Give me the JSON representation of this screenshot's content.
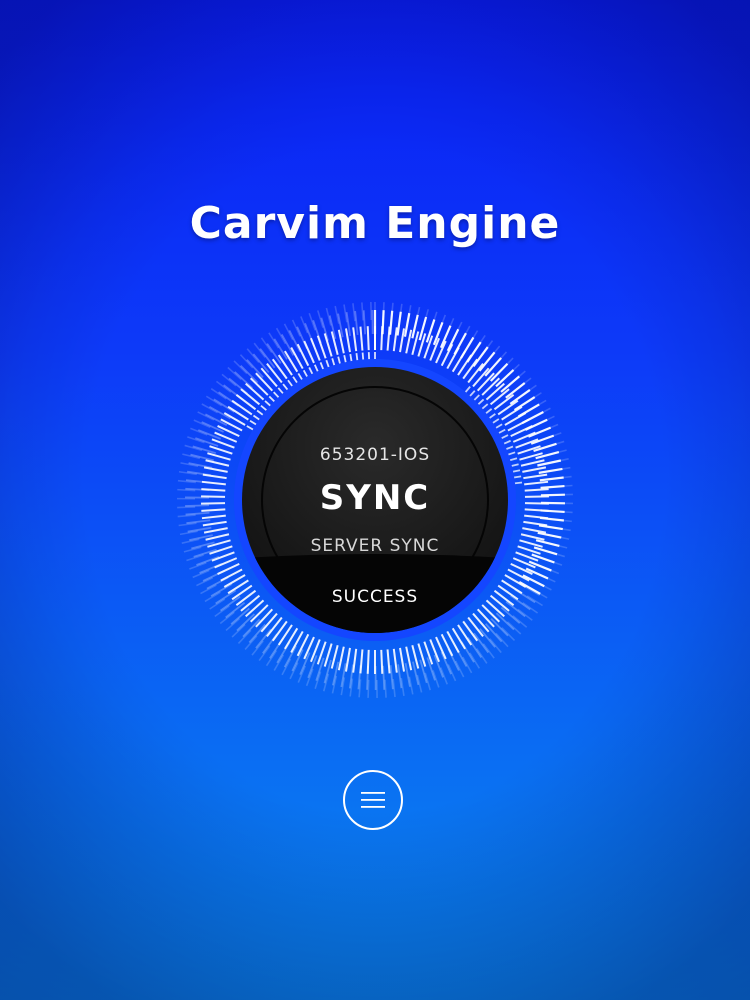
{
  "app": {
    "title": "Carvim Engine"
  },
  "sync_panel": {
    "device_id": "653201-IOS",
    "label": "SYNC",
    "description": "SERVER SYNC",
    "status": "SUCCESS"
  },
  "menu": {
    "icon": "hamburger-menu-icon"
  },
  "colors": {
    "background_top": "#0a1ff5",
    "background_bottom": "#0a8cf0",
    "dial_face": "#1a1a1a",
    "dial_ring": "#1446ff",
    "ticks": "#ffffff"
  }
}
